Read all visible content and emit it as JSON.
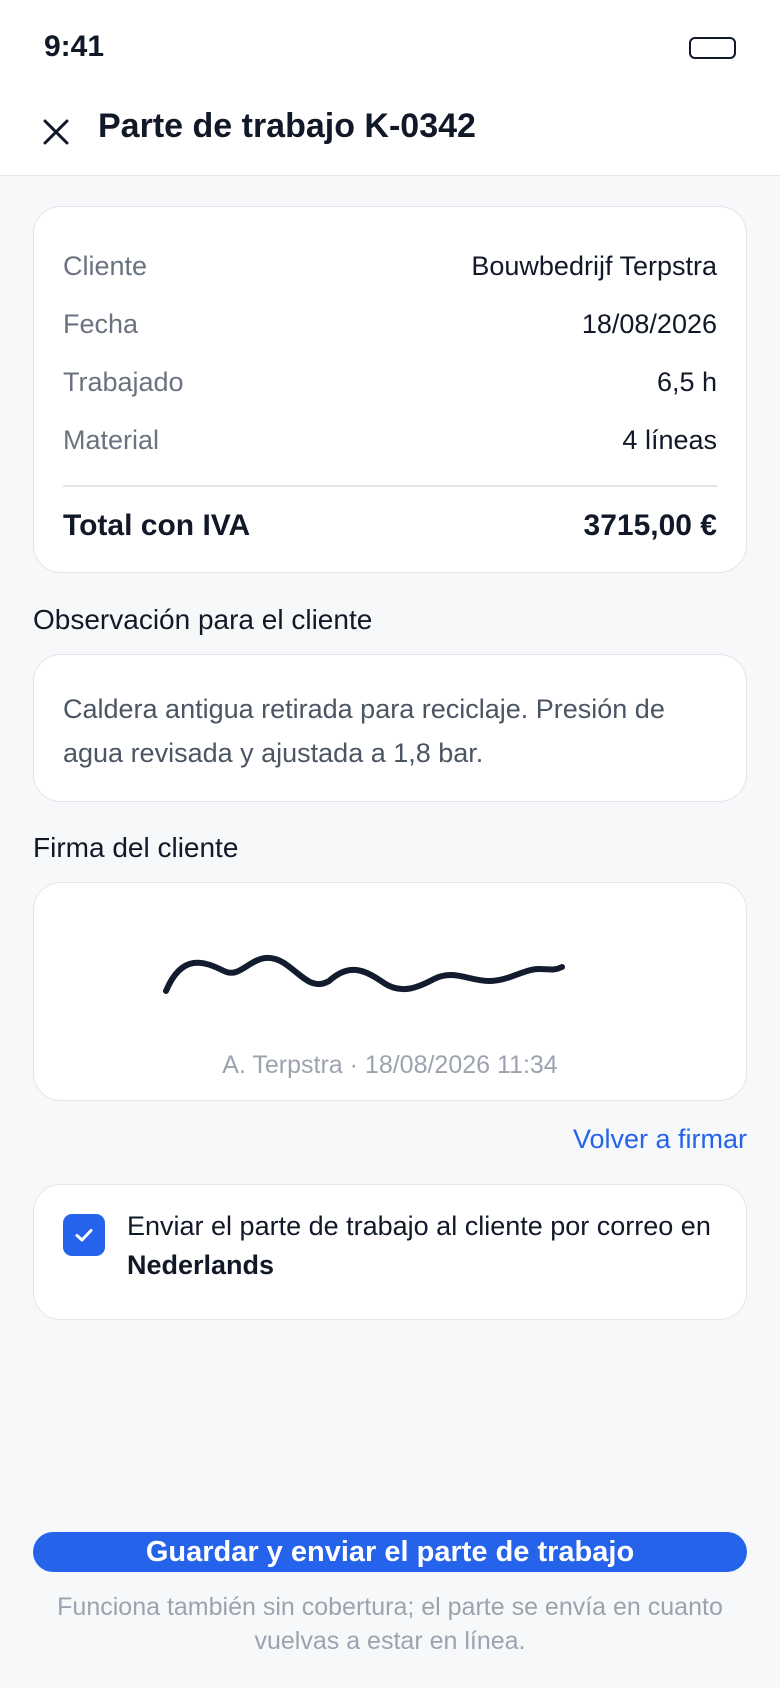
{
  "status_bar": {
    "time": "9:41"
  },
  "header": {
    "title": "Parte de trabajo K-0342"
  },
  "summary": {
    "rows": [
      {
        "label": "Cliente",
        "value": "Bouwbedrijf Terpstra"
      },
      {
        "label": "Fecha",
        "value": "18/08/2026"
      },
      {
        "label": "Trabajado",
        "value": "6,5 h"
      },
      {
        "label": "Material",
        "value": "4 líneas"
      }
    ],
    "total_label": "Total con IVA",
    "total_value": "3715,00 €"
  },
  "observation": {
    "label": "Observación para el cliente",
    "text": "Caldera antigua retirada para reciclaje. Presión de agua revisada y ajustada a 1,8 bar."
  },
  "signature": {
    "label": "Firma del cliente",
    "caption": "A. Terpstra · 18/08/2026 11:34",
    "resign_label": "Volver a firmar"
  },
  "email_option": {
    "checked": true,
    "text": "Enviar el parte de trabajo al cliente por correo en",
    "language": "Nederlands"
  },
  "actions": {
    "submit_label": "Guardar y enviar el parte de trabajo",
    "offline_note": "Funciona también sin cobertura; el parte se envía en cuanto vuelvas a estar en línea."
  },
  "colors": {
    "accent": "#2563eb",
    "background": "#f7f8fa",
    "text": "#111827",
    "muted": "#6b7280"
  }
}
